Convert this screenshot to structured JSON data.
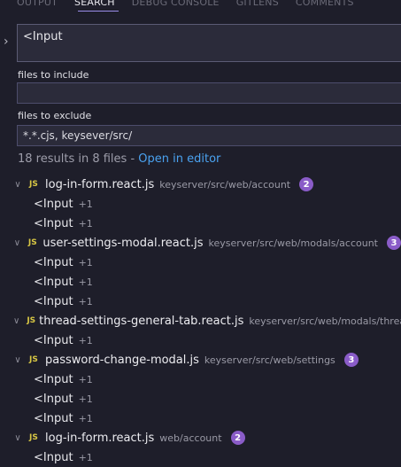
{
  "tabs": [
    "OUTPUT",
    "SEARCH",
    "DEBUG CONSOLE",
    "GITLENS",
    "COMMENTS"
  ],
  "search": {
    "value": "<Input"
  },
  "include": {
    "label": "files to include",
    "value": ""
  },
  "exclude": {
    "label": "files to exclude",
    "value": "*.*.cjs, keysever/src/"
  },
  "summary": {
    "text": "18 results in 8 files - ",
    "link": "Open in editor"
  },
  "results": [
    {
      "file": "log-in-form.react.js",
      "path": "keyserver/src/web/account",
      "count": "2",
      "matches": [
        {
          "text": "<Input",
          "extra": "+1"
        },
        {
          "text": "<Input",
          "extra": "+1"
        }
      ]
    },
    {
      "file": "user-settings-modal.react.js",
      "path": "keyserver/src/web/modals/account",
      "count": "3",
      "matches": [
        {
          "text": "<Input",
          "extra": "+1"
        },
        {
          "text": "<Input",
          "extra": "+1"
        },
        {
          "text": "<Input",
          "extra": "+1"
        }
      ]
    },
    {
      "file": "thread-settings-general-tab.react.js",
      "path": "keyserver/src/web/modals/threads",
      "count": "",
      "matches": [
        {
          "text": "<Input",
          "extra": "+1"
        }
      ]
    },
    {
      "file": "password-change-modal.js",
      "path": "keyserver/src/web/settings",
      "count": "3",
      "matches": [
        {
          "text": "<Input",
          "extra": "+1"
        },
        {
          "text": "<Input",
          "extra": "+1"
        },
        {
          "text": "<Input",
          "extra": "+1"
        }
      ]
    },
    {
      "file": "log-in-form.react.js",
      "path": "web/account",
      "count": "2",
      "matches": [
        {
          "text": "<Input",
          "extra": "+1"
        }
      ]
    }
  ],
  "icons": {
    "chevron": "chevron-down-icon",
    "toggle": "chevron-right-icon",
    "file": "js-file-icon"
  },
  "colors": {
    "accent": "#4aa2f0",
    "badge": "#8a5cc8",
    "js": "#d8c744"
  }
}
